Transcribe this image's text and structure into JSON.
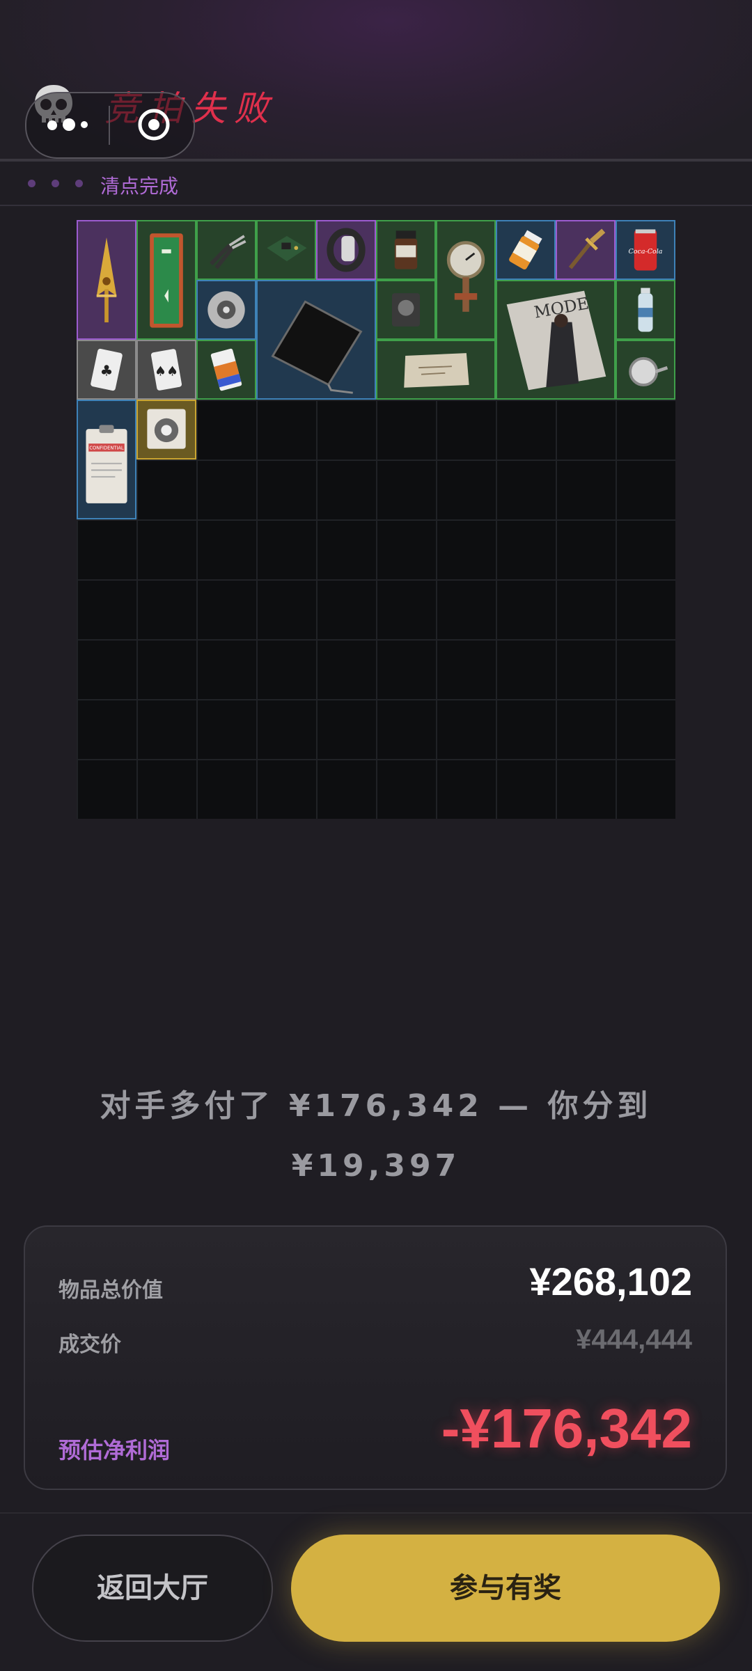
{
  "header": {
    "title": "竞拍失败",
    "status": "清点完成",
    "skull_icon": "skull-icon",
    "capsule": {
      "more_icon": "more-dots-icon",
      "close_icon": "target-circle-icon"
    }
  },
  "inventory": {
    "columns": 10,
    "rows": 10,
    "items": [
      {
        "name": "gold-arrow-pendant",
        "rarity": "purple"
      },
      {
        "name": "green-first-aid-cabinet",
        "rarity": "green"
      },
      {
        "name": "pliers",
        "rarity": "green"
      },
      {
        "name": "circuit-board",
        "rarity": "green"
      },
      {
        "name": "smart-watch",
        "rarity": "purple"
      },
      {
        "name": "medicine-jar",
        "rarity": "green"
      },
      {
        "name": "pressure-gauge-valve",
        "rarity": "green"
      },
      {
        "name": "pill-bottle",
        "rarity": "blue"
      },
      {
        "name": "ornate-dagger",
        "rarity": "purple"
      },
      {
        "name": "soda-can",
        "rarity": "blue"
      },
      {
        "name": "optical-disc-drive",
        "rarity": "blue"
      },
      {
        "name": "tablet",
        "rarity": "blue"
      },
      {
        "name": "hard-drive",
        "rarity": "green"
      },
      {
        "name": "fashion-magazine",
        "rarity": "green"
      },
      {
        "name": "water-bottle",
        "rarity": "green"
      },
      {
        "name": "playing-card-a",
        "rarity": "gray"
      },
      {
        "name": "playing-card-b",
        "rarity": "gray"
      },
      {
        "name": "battery",
        "rarity": "green"
      },
      {
        "name": "old-map",
        "rarity": "green"
      },
      {
        "name": "thermometer-dial",
        "rarity": "green"
      },
      {
        "name": "confidential-clipboard",
        "rarity": "blue"
      },
      {
        "name": "safe-dial",
        "rarity": "gold"
      }
    ],
    "magazine_text": "MODE",
    "can_text": "Coca-Cola",
    "clipboard_text": "CONFIDENTIAL"
  },
  "message": {
    "line1": "对手多付了 ¥176,342 — 你分到",
    "line2": "¥19,397"
  },
  "summary": {
    "total_label": "物品总价值",
    "total_value": "¥268,102",
    "deal_label": "成交价",
    "deal_value": "¥444,444",
    "profit_label": "预估净利润",
    "profit_value": "-¥176,342"
  },
  "buttons": {
    "back": "返回大厅",
    "prize": "参与有奖"
  },
  "colors": {
    "accent_purple": "#b06bd6",
    "loss_red": "#f04f5e",
    "title_red": "#e0304c",
    "gold_button": "#d4b142"
  }
}
